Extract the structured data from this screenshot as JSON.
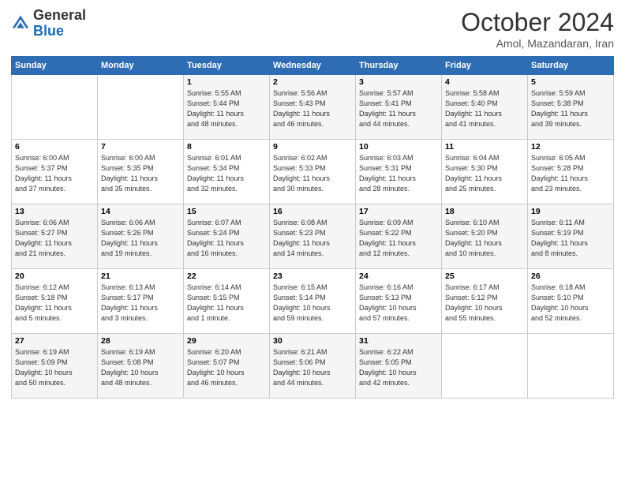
{
  "header": {
    "logo": {
      "line1": "General",
      "line2": "Blue"
    },
    "month": "October 2024",
    "location": "Amol, Mazandaran, Iran"
  },
  "weekdays": [
    "Sunday",
    "Monday",
    "Tuesday",
    "Wednesday",
    "Thursday",
    "Friday",
    "Saturday"
  ],
  "weeks": [
    [
      {
        "day": "",
        "info": ""
      },
      {
        "day": "",
        "info": ""
      },
      {
        "day": "1",
        "info": "Sunrise: 5:55 AM\nSunset: 5:44 PM\nDaylight: 11 hours\nand 48 minutes."
      },
      {
        "day": "2",
        "info": "Sunrise: 5:56 AM\nSunset: 5:43 PM\nDaylight: 11 hours\nand 46 minutes."
      },
      {
        "day": "3",
        "info": "Sunrise: 5:57 AM\nSunset: 5:41 PM\nDaylight: 11 hours\nand 44 minutes."
      },
      {
        "day": "4",
        "info": "Sunrise: 5:58 AM\nSunset: 5:40 PM\nDaylight: 11 hours\nand 41 minutes."
      },
      {
        "day": "5",
        "info": "Sunrise: 5:59 AM\nSunset: 5:38 PM\nDaylight: 11 hours\nand 39 minutes."
      }
    ],
    [
      {
        "day": "6",
        "info": "Sunrise: 6:00 AM\nSunset: 5:37 PM\nDaylight: 11 hours\nand 37 minutes."
      },
      {
        "day": "7",
        "info": "Sunrise: 6:00 AM\nSunset: 5:35 PM\nDaylight: 11 hours\nand 35 minutes."
      },
      {
        "day": "8",
        "info": "Sunrise: 6:01 AM\nSunset: 5:34 PM\nDaylight: 11 hours\nand 32 minutes."
      },
      {
        "day": "9",
        "info": "Sunrise: 6:02 AM\nSunset: 5:33 PM\nDaylight: 11 hours\nand 30 minutes."
      },
      {
        "day": "10",
        "info": "Sunrise: 6:03 AM\nSunset: 5:31 PM\nDaylight: 11 hours\nand 28 minutes."
      },
      {
        "day": "11",
        "info": "Sunrise: 6:04 AM\nSunset: 5:30 PM\nDaylight: 11 hours\nand 25 minutes."
      },
      {
        "day": "12",
        "info": "Sunrise: 6:05 AM\nSunset: 5:28 PM\nDaylight: 11 hours\nand 23 minutes."
      }
    ],
    [
      {
        "day": "13",
        "info": "Sunrise: 6:06 AM\nSunset: 5:27 PM\nDaylight: 11 hours\nand 21 minutes."
      },
      {
        "day": "14",
        "info": "Sunrise: 6:06 AM\nSunset: 5:26 PM\nDaylight: 11 hours\nand 19 minutes."
      },
      {
        "day": "15",
        "info": "Sunrise: 6:07 AM\nSunset: 5:24 PM\nDaylight: 11 hours\nand 16 minutes."
      },
      {
        "day": "16",
        "info": "Sunrise: 6:08 AM\nSunset: 5:23 PM\nDaylight: 11 hours\nand 14 minutes."
      },
      {
        "day": "17",
        "info": "Sunrise: 6:09 AM\nSunset: 5:22 PM\nDaylight: 11 hours\nand 12 minutes."
      },
      {
        "day": "18",
        "info": "Sunrise: 6:10 AM\nSunset: 5:20 PM\nDaylight: 11 hours\nand 10 minutes."
      },
      {
        "day": "19",
        "info": "Sunrise: 6:11 AM\nSunset: 5:19 PM\nDaylight: 11 hours\nand 8 minutes."
      }
    ],
    [
      {
        "day": "20",
        "info": "Sunrise: 6:12 AM\nSunset: 5:18 PM\nDaylight: 11 hours\nand 5 minutes."
      },
      {
        "day": "21",
        "info": "Sunrise: 6:13 AM\nSunset: 5:17 PM\nDaylight: 11 hours\nand 3 minutes."
      },
      {
        "day": "22",
        "info": "Sunrise: 6:14 AM\nSunset: 5:15 PM\nDaylight: 11 hours\nand 1 minute."
      },
      {
        "day": "23",
        "info": "Sunrise: 6:15 AM\nSunset: 5:14 PM\nDaylight: 10 hours\nand 59 minutes."
      },
      {
        "day": "24",
        "info": "Sunrise: 6:16 AM\nSunset: 5:13 PM\nDaylight: 10 hours\nand 57 minutes."
      },
      {
        "day": "25",
        "info": "Sunrise: 6:17 AM\nSunset: 5:12 PM\nDaylight: 10 hours\nand 55 minutes."
      },
      {
        "day": "26",
        "info": "Sunrise: 6:18 AM\nSunset: 5:10 PM\nDaylight: 10 hours\nand 52 minutes."
      }
    ],
    [
      {
        "day": "27",
        "info": "Sunrise: 6:19 AM\nSunset: 5:09 PM\nDaylight: 10 hours\nand 50 minutes."
      },
      {
        "day": "28",
        "info": "Sunrise: 6:19 AM\nSunset: 5:08 PM\nDaylight: 10 hours\nand 48 minutes."
      },
      {
        "day": "29",
        "info": "Sunrise: 6:20 AM\nSunset: 5:07 PM\nDaylight: 10 hours\nand 46 minutes."
      },
      {
        "day": "30",
        "info": "Sunrise: 6:21 AM\nSunset: 5:06 PM\nDaylight: 10 hours\nand 44 minutes."
      },
      {
        "day": "31",
        "info": "Sunrise: 6:22 AM\nSunset: 5:05 PM\nDaylight: 10 hours\nand 42 minutes."
      },
      {
        "day": "",
        "info": ""
      },
      {
        "day": "",
        "info": ""
      }
    ]
  ]
}
